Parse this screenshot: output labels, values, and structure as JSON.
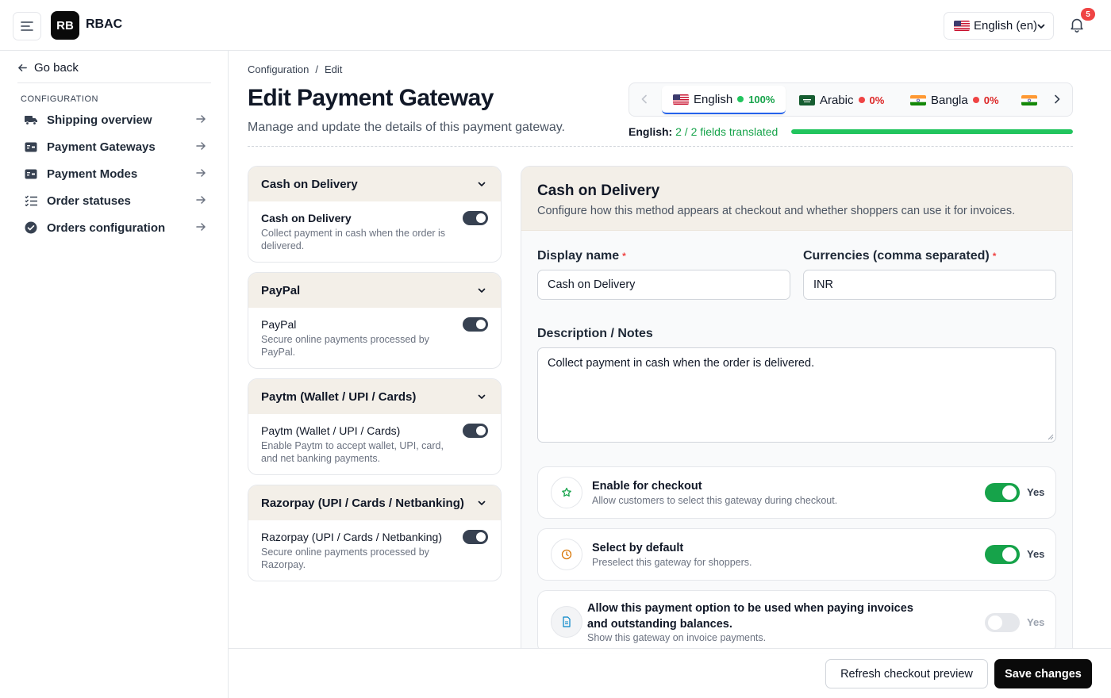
{
  "header": {
    "logo_text": "RB",
    "app_name": "RBAC",
    "language_select": "English (en)",
    "notification_count": "5"
  },
  "sidebar": {
    "go_back": "Go back",
    "section_title": "CONFIGURATION",
    "items": [
      {
        "label": "Shipping overview",
        "icon": "truck-icon"
      },
      {
        "label": "Payment Gateways",
        "icon": "credit-card-icon"
      },
      {
        "label": "Payment Modes",
        "icon": "credit-card-icon"
      },
      {
        "label": "Order statuses",
        "icon": "list-check-icon"
      },
      {
        "label": "Orders configuration",
        "icon": "check-circle-icon"
      }
    ]
  },
  "breadcrumb": {
    "parent": "Configuration",
    "separator": "/",
    "current": "Edit"
  },
  "page": {
    "title": "Edit Payment Gateway",
    "subtitle": "Manage and update the details of this payment gateway."
  },
  "language_tabs": [
    {
      "label": "English",
      "percent": "100%",
      "status_color": "#22c55e",
      "active": true
    },
    {
      "label": "Arabic",
      "percent": "0%",
      "status_color": "#ef4444",
      "active": false
    },
    {
      "label": "Bangla",
      "percent": "0%",
      "status_color": "#ef4444",
      "active": false
    }
  ],
  "translation_status": {
    "label": "English:",
    "value": "2 / 2 fields translated",
    "progress": 1.0
  },
  "gateways": [
    {
      "header": "Cash on Delivery",
      "name": "Cash on Delivery",
      "description": "Collect payment in cash when the order is delivered.",
      "enabled": true,
      "selected": true
    },
    {
      "header": "PayPal",
      "name": "PayPal",
      "description": "Secure online payments processed by PayPal.",
      "enabled": true,
      "selected": false
    },
    {
      "header": "Paytm (Wallet / UPI / Cards)",
      "name": "Paytm (Wallet / UPI / Cards)",
      "description": "Enable Paytm to accept wallet, UPI, card, and net banking payments.",
      "enabled": true,
      "selected": false
    },
    {
      "header": "Razorpay (UPI / Cards / Netbanking)",
      "name": "Razorpay (UPI / Cards / Netbanking)",
      "description": "Secure online payments processed by Razorpay.",
      "enabled": true,
      "selected": false
    }
  ],
  "editor": {
    "title": "Cash on Delivery",
    "subtitle": "Configure how this method appears at checkout and whether shoppers can use it for invoices.",
    "display_name_label": "Display name",
    "display_name_value": "Cash on Delivery",
    "currencies_label": "Currencies (comma separated)",
    "currencies_value": "INR",
    "required_mark": "*",
    "description_label": "Description / Notes",
    "description_value": "Collect payment in cash when the order is delivered.",
    "options": [
      {
        "title": "Enable for checkout",
        "description": "Allow customers to select this gateway during checkout.",
        "toggle_label": "Yes",
        "on": true
      },
      {
        "title": "Select by default",
        "description": "Preselect this gateway for shoppers.",
        "toggle_label": "Yes",
        "on": true
      },
      {
        "title": "Allow this payment option to be used when paying invoices and outstanding balances.",
        "description": "Show this gateway on invoice payments.",
        "toggle_label": "Yes",
        "on": false
      }
    ]
  },
  "footer": {
    "refresh_label": "Refresh checkout preview",
    "save_label": "Save changes"
  },
  "colors": {
    "accent_green": "#16a34a",
    "header_beige": "#f3efe8",
    "danger": "#ef4444",
    "primary_dark": "#0a0a0a"
  }
}
